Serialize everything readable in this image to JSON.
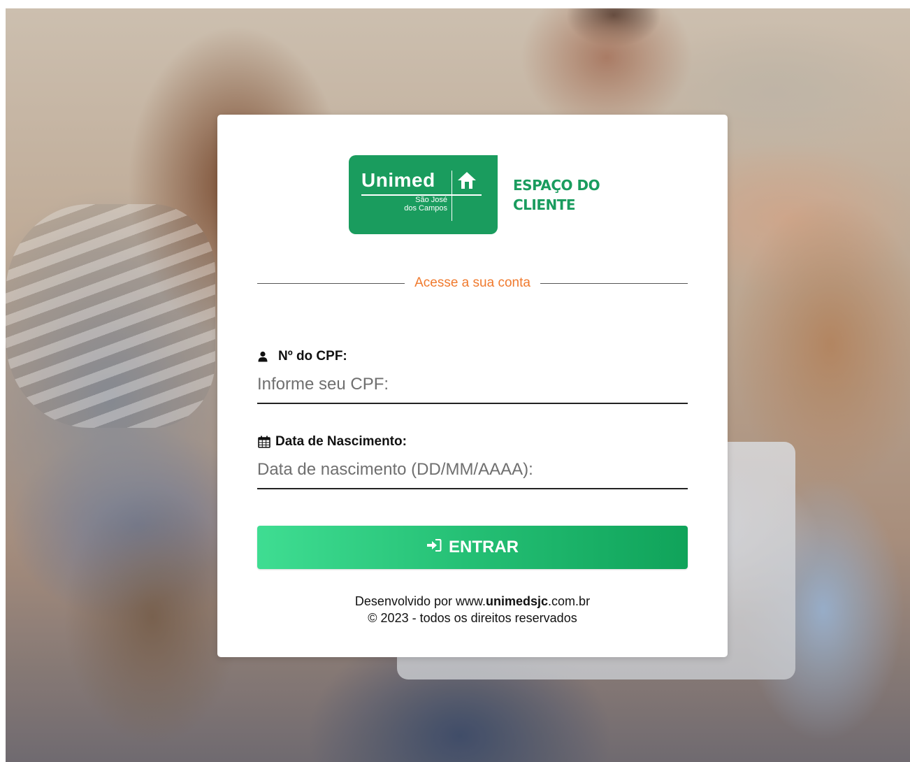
{
  "background": {
    "icon": "family-photo-background"
  },
  "brand": {
    "logo_word": "Unimed",
    "logo_sub_line1": "São José",
    "logo_sub_line2": "dos Campos",
    "title_line1": "ESPAÇO DO",
    "title_line2": "CLIENTE",
    "color": "#1a9c5e"
  },
  "login": {
    "heading": "Acesse a sua conta",
    "heading_color": "#f07a2e",
    "cpf": {
      "label": "Nº do CPF:",
      "placeholder": "Informe seu CPF:",
      "value": "",
      "icon": "user-icon"
    },
    "birthdate": {
      "label": "Data de Nascimento:",
      "placeholder": "Data de nascimento (DD/MM/AAAA):",
      "value": "",
      "icon": "calendar-icon"
    },
    "submit": {
      "label": "ENTRAR",
      "icon": "sign-in-icon",
      "colors": [
        "#3fdd92",
        "#10a35a"
      ]
    }
  },
  "footer": {
    "dev_prefix": "Desenvolvido por www.",
    "dev_domain_bold": "unimedsjc",
    "dev_suffix": ".com.br",
    "copyright": "© 2023 - todos os direitos reservados"
  }
}
